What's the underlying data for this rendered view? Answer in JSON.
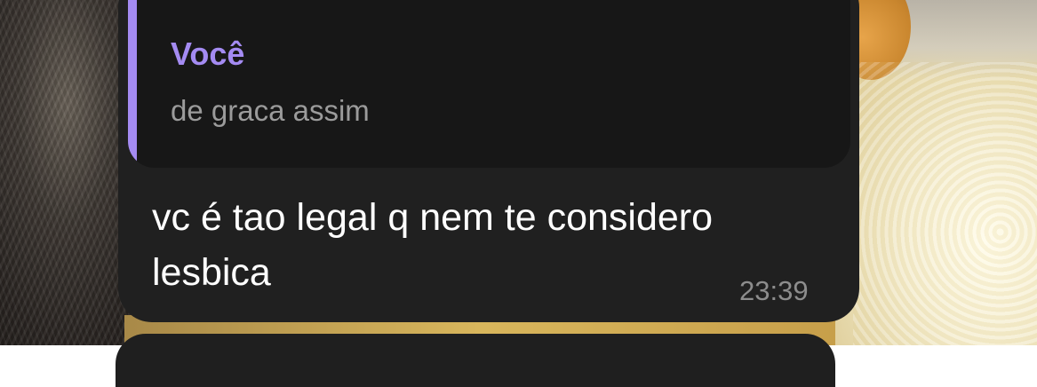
{
  "message": {
    "reply": {
      "author": "Você",
      "text": "de graca assim"
    },
    "text": "vc é tao legal q nem te considero lesbica",
    "time": "23:39"
  },
  "colors": {
    "bubble": "#202020",
    "reply_background": "#171717",
    "reply_accent": "#a48bf2",
    "message_text": "#ffffff",
    "secondary_text": "#9b9b9b"
  }
}
